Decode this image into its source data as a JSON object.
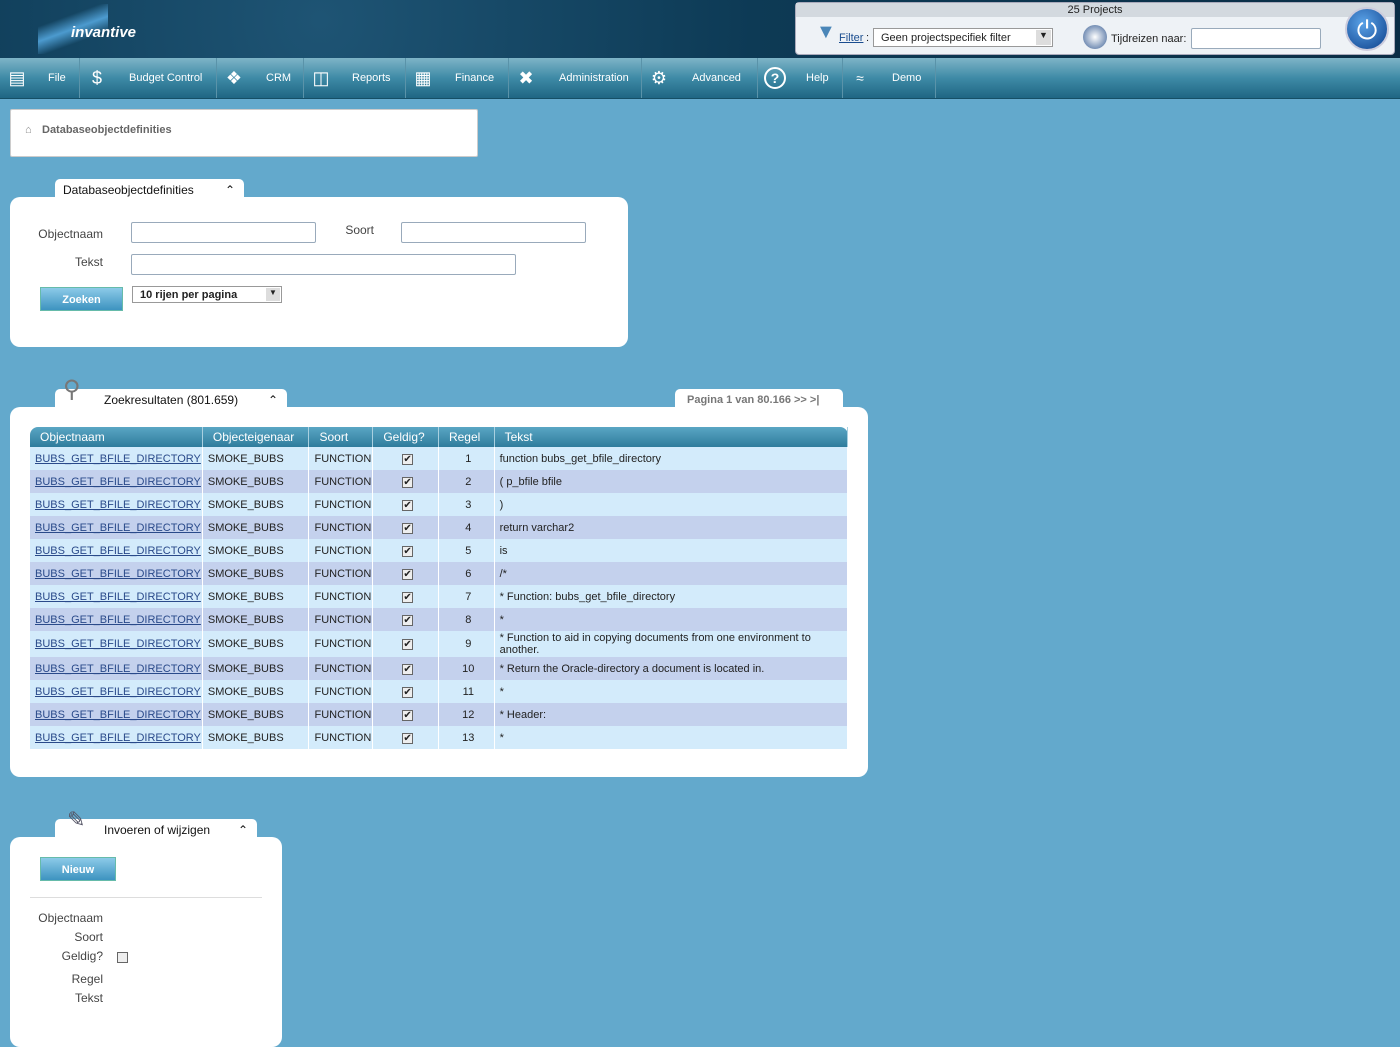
{
  "header": {
    "logo": "invantive",
    "projects": "25 Projects",
    "filter_label": "Filter",
    "filter_value": "Geen projectspecifiek filter",
    "timetravel_label": "Tijdreizen naar:",
    "timetravel_value": ""
  },
  "nav": [
    {
      "label": "File",
      "icon": "cabinet-icon"
    },
    {
      "label": "Budget Control",
      "icon": "money-bag-icon"
    },
    {
      "label": "CRM",
      "icon": "handshake-icon"
    },
    {
      "label": "Reports",
      "icon": "presentation-icon"
    },
    {
      "label": "Finance",
      "icon": "calculator-icon"
    },
    {
      "label": "Administration",
      "icon": "tools-icon"
    },
    {
      "label": "Advanced",
      "icon": "gears-icon"
    },
    {
      "label": "Help",
      "icon": "help-icon"
    },
    {
      "label": "Demo",
      "icon": "demo-logo-icon"
    }
  ],
  "breadcrumb": "Databaseobjectdefinities",
  "search": {
    "title": "Databaseobjectdefinities",
    "objectnaam_label": "Objectnaam",
    "soort_label": "Soort",
    "tekst_label": "Tekst",
    "objectnaam_value": "",
    "soort_value": "",
    "tekst_value": "",
    "button": "Zoeken",
    "rows_per_page": "10 rijen per pagina"
  },
  "results": {
    "title": "Zoekresultaten (801.659)",
    "pager": "Pagina 1 van 80.166  >>  >|",
    "columns": [
      "Objectnaam",
      "Objecteigenaar",
      "Soort",
      "Geldig?",
      "Regel",
      "Tekst"
    ],
    "rows": [
      [
        "BUBS_GET_BFILE_DIRECTORY",
        "SMOKE_BUBS",
        "FUNCTION",
        true,
        "1",
        "function bubs_get_bfile_directory"
      ],
      [
        "BUBS_GET_BFILE_DIRECTORY",
        "SMOKE_BUBS",
        "FUNCTION",
        true,
        "2",
        "( p_bfile bfile"
      ],
      [
        "BUBS_GET_BFILE_DIRECTORY",
        "SMOKE_BUBS",
        "FUNCTION",
        true,
        "3",
        ")"
      ],
      [
        "BUBS_GET_BFILE_DIRECTORY",
        "SMOKE_BUBS",
        "FUNCTION",
        true,
        "4",
        "return varchar2"
      ],
      [
        "BUBS_GET_BFILE_DIRECTORY",
        "SMOKE_BUBS",
        "FUNCTION",
        true,
        "5",
        "is"
      ],
      [
        "BUBS_GET_BFILE_DIRECTORY",
        "SMOKE_BUBS",
        "FUNCTION",
        true,
        "6",
        "/*"
      ],
      [
        "BUBS_GET_BFILE_DIRECTORY",
        "SMOKE_BUBS",
        "FUNCTION",
        true,
        "7",
        "* Function: bubs_get_bfile_directory"
      ],
      [
        "BUBS_GET_BFILE_DIRECTORY",
        "SMOKE_BUBS",
        "FUNCTION",
        true,
        "8",
        "*"
      ],
      [
        "BUBS_GET_BFILE_DIRECTORY",
        "SMOKE_BUBS",
        "FUNCTION",
        true,
        "9",
        "* Function to aid in copying documents from one environment to another."
      ],
      [
        "BUBS_GET_BFILE_DIRECTORY",
        "SMOKE_BUBS",
        "FUNCTION",
        true,
        "10",
        "* Return the Oracle-directory a document is located in."
      ],
      [
        "BUBS_GET_BFILE_DIRECTORY",
        "SMOKE_BUBS",
        "FUNCTION",
        true,
        "11",
        "*"
      ],
      [
        "BUBS_GET_BFILE_DIRECTORY",
        "SMOKE_BUBS",
        "FUNCTION",
        true,
        "12",
        "* Header:"
      ],
      [
        "BUBS_GET_BFILE_DIRECTORY",
        "SMOKE_BUBS",
        "FUNCTION",
        true,
        "13",
        "*"
      ]
    ]
  },
  "edit": {
    "title": "Invoeren of wijzigen",
    "new_button": "Nieuw",
    "fields": [
      "Objectnaam",
      "Soort",
      "Geldig?",
      "Regel",
      "Tekst"
    ]
  }
}
